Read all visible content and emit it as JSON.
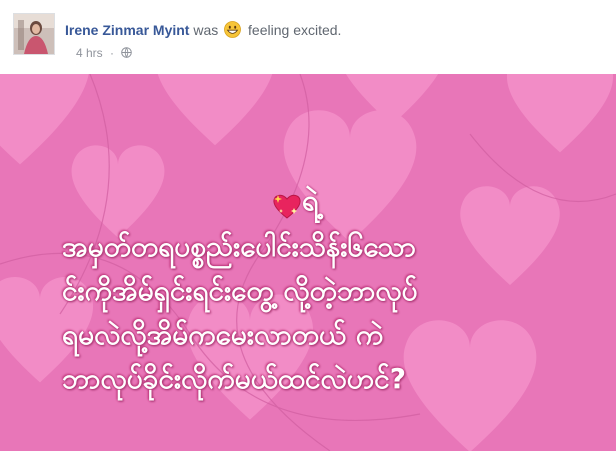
{
  "post": {
    "author": "Irene Zinmar Myint",
    "was_text": "was",
    "feeling_text": "feeling excited.",
    "emoji_icon": "grinning-face-icon",
    "timestamp": "4 hrs",
    "separator": "·",
    "privacy_icon": "globe-icon"
  },
  "image": {
    "sticker_icon": "sparkling-heart-icon",
    "caption_lead": "ရဲ့",
    "caption_lines": [
      "အမှတ်တရပစ္စည်းပေါင်းသိန်း၆သော",
      "င်းကိုအိမ်ရှင်းရင်းတွေ့ လို့တဲ့ဘာလုပ်",
      "ရမလဲလို့အိမ်ကမေးလာတယ် ကဲ",
      "ဘာလုပ်ခိုင်းလိုက်မယ်ထင်လဲဟင်?"
    ],
    "colors": {
      "background": "#e876b8",
      "heart": "#f07fc0",
      "text": "#ffffff"
    }
  }
}
